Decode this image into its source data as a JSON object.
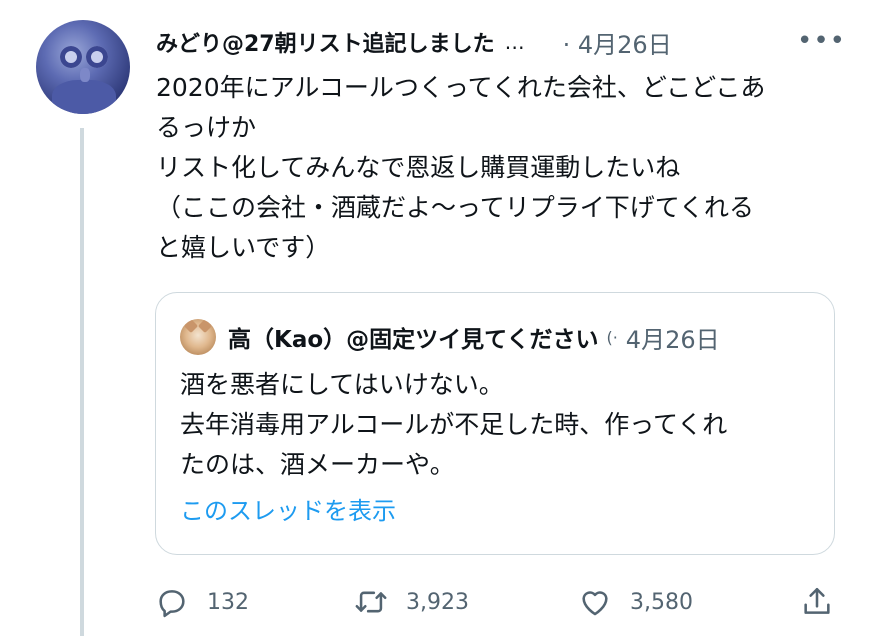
{
  "tweet": {
    "name": "みどり@27朝リスト追記しました",
    "ellipsis": "…",
    "time": "· 4月26日",
    "more": "•••",
    "lines": [
      "2020年にアルコールつくってくれた会社、どこどこあ",
      "るっけか",
      "リスト化してみんなで恩返し購買運動したいね",
      "（ここの会社・酒蔵だよ〜ってリプライ下げてくれる",
      "と嬉しいです）"
    ]
  },
  "quote": {
    "name": "高（Kao）@固定ツイ見てください",
    "sep": "(·",
    "time": "4月26日",
    "lines": [
      "酒を悪者にしてはいけない。",
      "去年消毒用アルコールが不足した時、作ってくれ",
      "たのは、酒メーカーや。"
    ],
    "thread_link": "このスレッドを表示"
  },
  "actions": {
    "reply_count": "132",
    "retweet_count": "3,923",
    "like_count": "3,580"
  },
  "colors": {
    "text": "#0f1419",
    "secondary": "#536471",
    "link": "#1d9bf0",
    "border": "#cfd9de"
  },
  "icons": [
    "reply-icon",
    "retweet-icon",
    "like-icon",
    "share-icon",
    "more-icon"
  ]
}
